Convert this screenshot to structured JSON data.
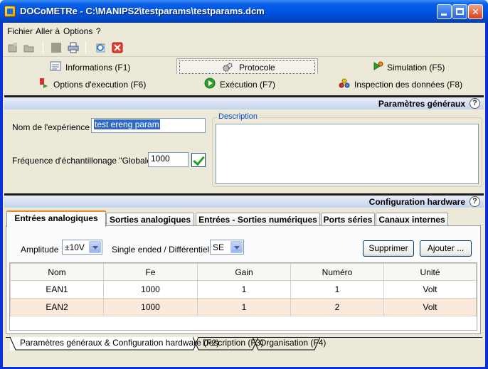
{
  "window": {
    "title": "DOCoMETRe - C:\\MANIPS2\\testparams\\testparams.dcm",
    "minimize_label": "",
    "maximize_label": "",
    "close_label": "✕"
  },
  "menu": [
    "Fichier",
    "Aller à",
    "Options",
    "?"
  ],
  "toolbar": {
    "icons": [
      "new-icon",
      "open-icon",
      "save-icon",
      "print-icon",
      "refresh-icon",
      "delete-icon"
    ]
  },
  "main_tabs": {
    "row1": [
      {
        "label": "Informations (F1)",
        "icon": "info-doc-icon"
      },
      {
        "label": "Protocole",
        "icon": "gears-icon",
        "selected": true
      },
      {
        "label": "Simulation (F5)",
        "icon": "simulation-icon"
      }
    ],
    "row2": [
      {
        "label": "Options d'execution (F6)",
        "icon": "options-icon"
      },
      {
        "label": "Exécution (F7)",
        "icon": "play-icon"
      },
      {
        "label": "Inspection des données (F8)",
        "icon": "inspect-icon"
      }
    ]
  },
  "general": {
    "section_title": "Paramètres généraux",
    "name_label": "Nom de l'expérience  :",
    "name_value": "test ereng param",
    "freq_label": "Fréquence d'échantillonage \"Globale\" :",
    "freq_value": "1000",
    "description_label": "Description",
    "description_value": ""
  },
  "hardware": {
    "section_title": "Configuration hardware",
    "tabs": [
      "Entrées analogiques",
      "Sorties analogiques",
      "Entrées - Sorties numériques",
      "Ports séries",
      "Canaux internes"
    ],
    "active_tab": 0,
    "amplitude_label": "Amplitude :",
    "amplitude_value": "±10V",
    "mode_label": "Single ended / Différentiel :",
    "mode_value": "SE",
    "remove_button": "Supprimer",
    "add_button": "Ajouter ...",
    "table": {
      "columns": [
        "Nom",
        "Fe",
        "Gain",
        "Numéro",
        "Unité"
      ],
      "rows": [
        [
          "EAN1",
          "1000",
          "1",
          "1",
          "Volt"
        ],
        [
          "EAN2",
          "1000",
          "1",
          "2",
          "Volt"
        ]
      ]
    }
  },
  "bottom_tabs": [
    "Paramètres généraux & Configuration hardware (F2)",
    "Description (F3)",
    "Organisation (F4)"
  ],
  "colors": {
    "title_bar": "#0054e3",
    "section_bar": "#c5d3ec",
    "row_alt": "#fbe9dc",
    "tab_accent": "#e68b2c"
  }
}
